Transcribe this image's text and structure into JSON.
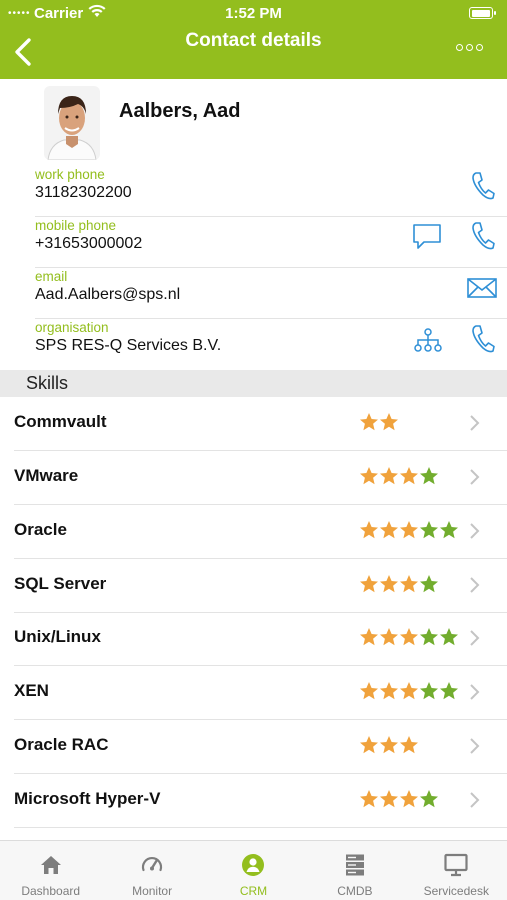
{
  "status_bar": {
    "carrier": "Carrier",
    "time": "1:52 PM"
  },
  "nav": {
    "title": "Contact details",
    "back_icon": "chevron-left-icon",
    "more_icon": "more-dots-icon"
  },
  "contact": {
    "name": "Aalbers, Aad",
    "fields": [
      {
        "label": "work phone",
        "value": "31182302200"
      },
      {
        "label": "mobile phone",
        "value": "+31653000002"
      },
      {
        "label": "email",
        "value": "Aad.Aalbers@sps.nl"
      },
      {
        "label": "organisation",
        "value": "SPS RES-Q Services B.V."
      }
    ]
  },
  "skills": {
    "header": "Skills",
    "items": [
      {
        "name": "Commvault",
        "stars": 2,
        "orange": 2
      },
      {
        "name": "VMware",
        "stars": 4,
        "orange": 3
      },
      {
        "name": "Oracle",
        "stars": 5,
        "orange": 3
      },
      {
        "name": "SQL Server",
        "stars": 4,
        "orange": 3
      },
      {
        "name": "Unix/Linux",
        "stars": 5,
        "orange": 3
      },
      {
        "name": "XEN",
        "stars": 5,
        "orange": 3
      },
      {
        "name": "Oracle RAC",
        "stars": 3,
        "orange": 3
      },
      {
        "name": "Microsoft Hyper-V",
        "stars": 4,
        "orange": 3
      }
    ]
  },
  "tabbar": {
    "tabs": [
      {
        "label": "Dashboard",
        "icon": "home-icon"
      },
      {
        "label": "Monitor",
        "icon": "gauge-icon"
      },
      {
        "label": "CRM",
        "icon": "person-icon"
      },
      {
        "label": "CMDB",
        "icon": "server-icon"
      },
      {
        "label": "Servicedesk",
        "icon": "monitor-icon"
      }
    ],
    "active": "CRM"
  },
  "colors": {
    "brand": "#93be1e",
    "link_blue": "#2e8fd6",
    "star_orange": "#f0a23c",
    "star_green": "#72ad2e"
  }
}
